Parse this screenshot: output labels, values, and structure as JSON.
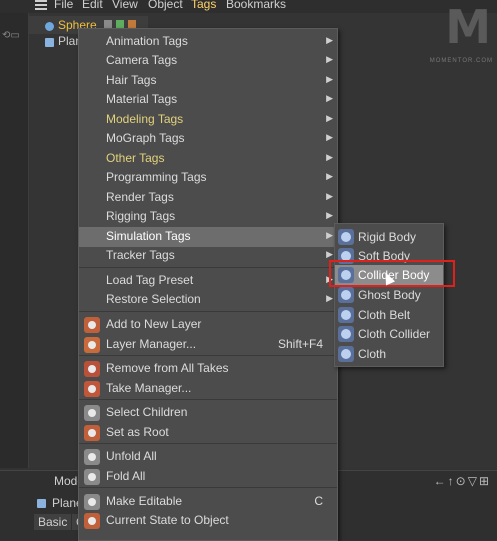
{
  "menubar": {
    "items": [
      "File",
      "Edit",
      "View",
      "Object",
      "Tags",
      "Bookmarks"
    ],
    "active": "Tags"
  },
  "objects": {
    "sphere": "Sphere",
    "plane": "Plan"
  },
  "logo": {
    "letter": "M",
    "text": "MOMENTOR.COM"
  },
  "menu": {
    "items": [
      {
        "label": "Animation Tags",
        "submenu": true
      },
      {
        "label": "Camera Tags",
        "submenu": true
      },
      {
        "label": "Hair Tags",
        "submenu": true
      },
      {
        "label": "Material Tags",
        "submenu": true
      },
      {
        "label": "Modeling Tags",
        "submenu": true
      },
      {
        "label": "MoGraph Tags",
        "submenu": true
      },
      {
        "label": "Other Tags",
        "submenu": true
      },
      {
        "label": "Programming Tags",
        "submenu": true
      },
      {
        "label": "Render Tags",
        "submenu": true
      },
      {
        "label": "Rigging Tags",
        "submenu": true
      },
      {
        "label": "Simulation Tags",
        "submenu": true,
        "highlighted": true
      },
      {
        "label": "Tracker Tags",
        "submenu": true
      },
      {
        "label": "Load Tag Preset",
        "submenu": true
      },
      {
        "label": "Restore Selection",
        "submenu": true
      },
      {
        "label": "Add to New Layer",
        "icon": "layer-add-icon"
      },
      {
        "label": "Layer Manager...",
        "shortcut": "Shift+F4",
        "icon": "layer-manager-icon"
      },
      {
        "label": "Remove from All Takes",
        "icon": "takes-remove-icon"
      },
      {
        "label": "Take Manager...",
        "icon": "take-manager-icon"
      },
      {
        "label": "Select Children",
        "icon": "select-children-icon"
      },
      {
        "label": "Set as Root",
        "icon": "set-root-icon"
      },
      {
        "label": "Unfold All",
        "icon": "unfold-icon"
      },
      {
        "label": "Fold All",
        "icon": "fold-icon"
      },
      {
        "label": "Make Editable",
        "shortcut": "C",
        "icon": "make-editable-icon"
      },
      {
        "label": "Current State to Object",
        "icon": "current-state-icon"
      }
    ]
  },
  "submenu": {
    "items": [
      {
        "label": "Rigid Body",
        "icon": "rigid-body-icon"
      },
      {
        "label": "Soft Body",
        "icon": "soft-body-icon"
      },
      {
        "label": "Collider Body",
        "icon": "collider-body-icon",
        "highlighted": true
      },
      {
        "label": "Ghost Body",
        "icon": "ghost-body-icon"
      },
      {
        "label": "Cloth Belt",
        "icon": "cloth-belt-icon"
      },
      {
        "label": "Cloth Collider",
        "icon": "cloth-collider-icon"
      },
      {
        "label": "Cloth",
        "icon": "cloth-icon"
      }
    ]
  },
  "attributes": {
    "title": "Mode",
    "object": "Plane",
    "tabs": [
      "Basic",
      "C"
    ]
  },
  "colors": {
    "accent_yellow": "#e2d27c",
    "highlight_red": "#e0201a",
    "menu_bg": "#4c4c4c"
  }
}
